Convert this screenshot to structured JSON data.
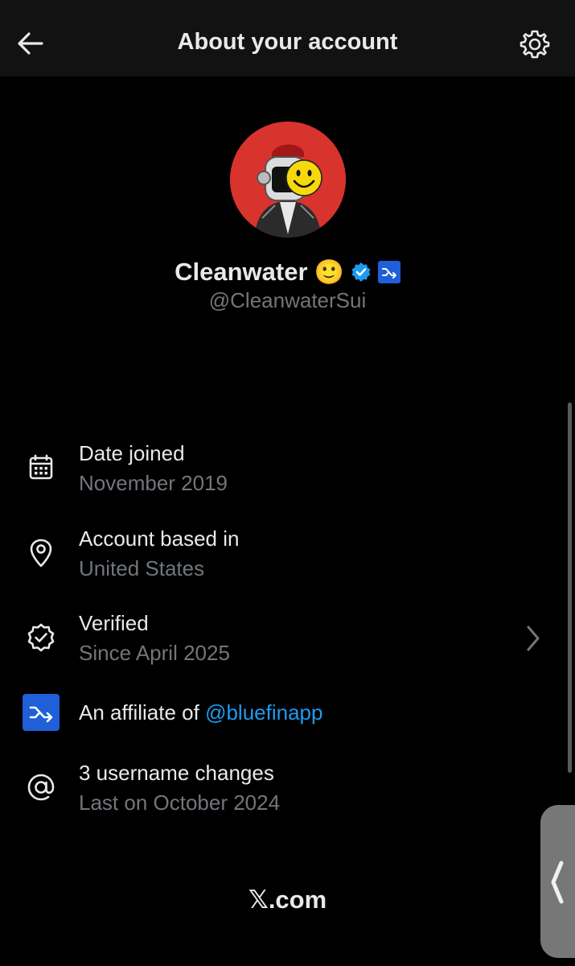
{
  "header": {
    "title": "About your account",
    "back_icon": "arrow-left-icon",
    "settings_icon": "gear-icon"
  },
  "profile": {
    "display_name": "Cleanwater",
    "emoji": "🙂",
    "handle": "@CleanwaterSui",
    "verified_badge_color": "#1d9bf0",
    "affiliate_badge_color": "#1f5fd8",
    "avatar_bg_color": "#d9332e"
  },
  "details": {
    "date_joined": {
      "title": "Date joined",
      "value": "November 2019",
      "icon": "calendar-icon"
    },
    "account_based": {
      "title": "Account based in",
      "value": "United States",
      "icon": "location-pin-icon"
    },
    "verified": {
      "title": "Verified",
      "value": "Since April 2025",
      "icon": "verified-check-icon"
    },
    "affiliate": {
      "prefix": "An affiliate of ",
      "link": "@bluefinapp",
      "icon": "affiliate-badge-icon"
    },
    "username_changes": {
      "title": "3 username changes",
      "value": "Last on October 2024",
      "icon": "at-sign-icon"
    }
  },
  "footer": {
    "logo_text": ".com",
    "logo_mark": "𝕏"
  },
  "colors": {
    "background": "#000000",
    "header_bg": "#121212",
    "primary_text": "#e7e9ea",
    "secondary_text": "#71767b",
    "link": "#1d9bf0"
  }
}
